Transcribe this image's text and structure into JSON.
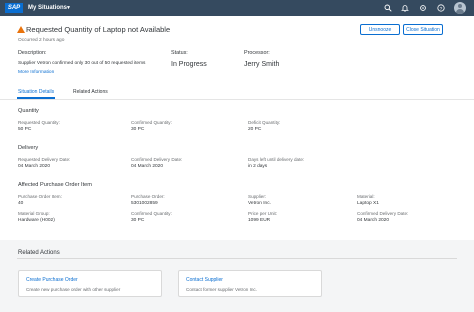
{
  "shell": {
    "logo": "SAP",
    "title": "My Situations",
    "icons": [
      "search-icon",
      "bell-icon",
      "settings-icon",
      "help-icon"
    ]
  },
  "header": {
    "title": "Requested Quantity of Laptop not Available",
    "subtitle": "Occurred 2 hours ago",
    "unsnooze_label": "Unsnooze",
    "close_label": "Close Situation",
    "description_label": "Description:",
    "description_text": "Supplier Vetron confirmed only 30 out of 50 requested items",
    "more_info": "More Information",
    "status_label": "Status:",
    "status_value": "In Progress",
    "processor_label": "Processor:",
    "processor_value": "Jerry Smith"
  },
  "tabs": [
    {
      "label": "Situation Details",
      "active": true
    },
    {
      "label": "Related Actions",
      "active": false
    }
  ],
  "details": {
    "quantity": {
      "title": "Quantity",
      "fields": [
        {
          "label": "Requested Quantity:",
          "value": "50 PC"
        },
        {
          "label": "Confirmed Quantity:",
          "value": "30 PC"
        },
        {
          "label": "Deficit Quantity:",
          "value": "20 PC"
        }
      ]
    },
    "delivery": {
      "title": "Delivery",
      "fields": [
        {
          "label": "Requested Delivery Date:",
          "value": "04 March 2020"
        },
        {
          "label": "Confirmed Delivery Date:",
          "value": "04 March 2020"
        },
        {
          "label": "Days left until delivery date:",
          "value": "in 2 days"
        }
      ]
    },
    "po_item": {
      "title": "Affected Purchase Order Item",
      "fields": [
        {
          "label": "Purchase Order Item:",
          "value": "40"
        },
        {
          "label": "Purchase Order:",
          "value": "5301002859"
        },
        {
          "label": "Supplier:",
          "value": "Vetron Inc."
        },
        {
          "label": "Material:",
          "value": "Laptop X1"
        },
        {
          "label": "Material Group:",
          "value": "Hardware (H002)"
        },
        {
          "label": "Confirmed Quantity:",
          "value": "30 PC"
        },
        {
          "label": "Price per Unit:",
          "value": "1099 EUR"
        },
        {
          "label": "Confirmed Delivery Date:",
          "value": "04 March 2020"
        }
      ]
    }
  },
  "related_actions": {
    "title": "Related Actions",
    "cards": [
      {
        "title": "Create Purchase Order",
        "desc": "Create new purchase order with other supplier"
      },
      {
        "title": "Contact Supplier",
        "desc": "Contact former supplier Vetron Inc."
      }
    ]
  },
  "colors": {
    "shell": "#354a5f",
    "accent": "#0a6ed1",
    "warning": "#e9730c",
    "background": "#f4f5f6"
  }
}
